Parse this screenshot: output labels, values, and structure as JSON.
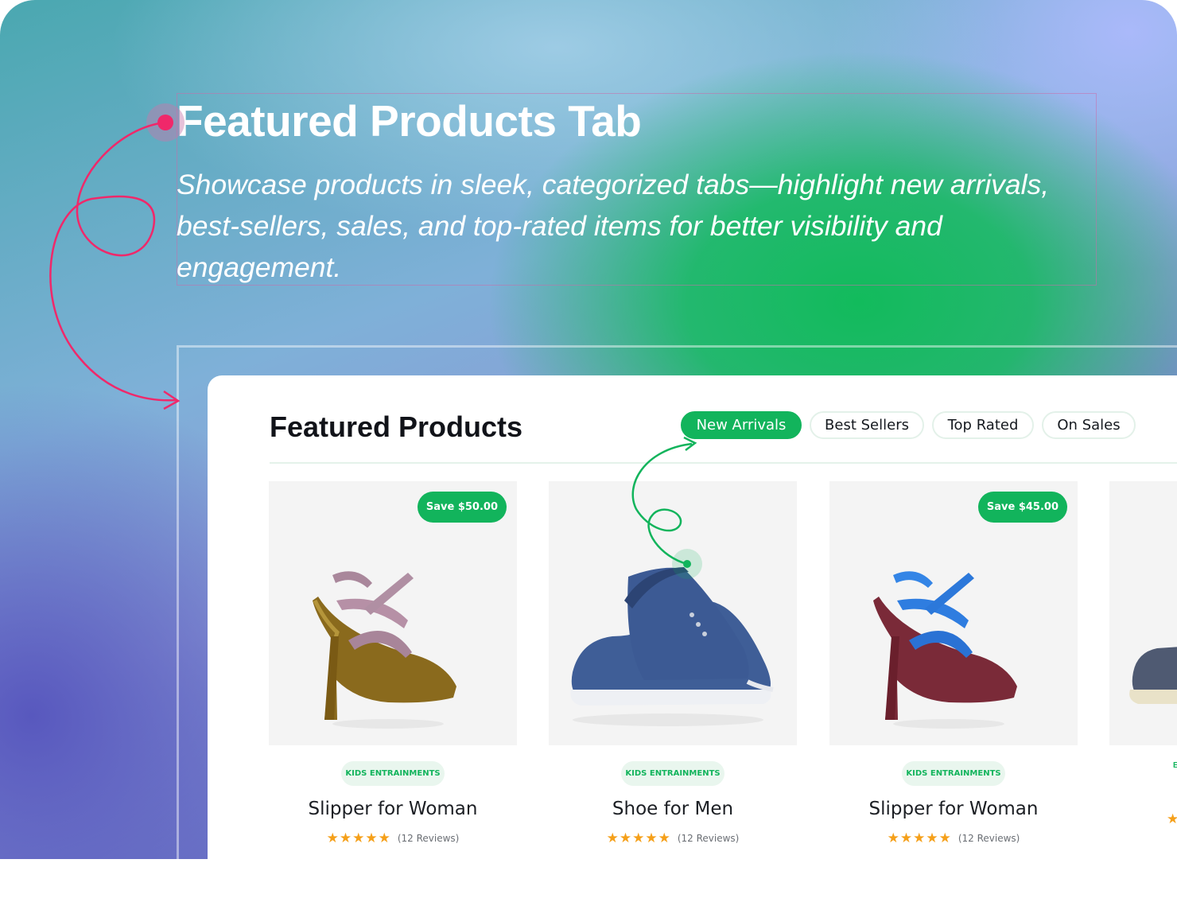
{
  "hero": {
    "title": "Featured Products Tab",
    "description": "Showcase products in sleek, categorized tabs—highlight new arrivals, best-sellers, sales, and top-rated items for better visibility and engagement."
  },
  "panel": {
    "title": "Featured Products",
    "tabs": [
      {
        "label": "New Arrivals",
        "active": true
      },
      {
        "label": "Best Sellers",
        "active": false
      },
      {
        "label": "Top Rated",
        "active": false
      },
      {
        "label": "On Sales",
        "active": false
      }
    ]
  },
  "products": [
    {
      "name": "Slipper for Woman",
      "category": "KIDS ENTRAINMENTS",
      "badge": "Save $50.00",
      "stars": "★★★★★",
      "reviews": "(12 Reviews)",
      "image": "high-heel-sandal-gold"
    },
    {
      "name": "Shoe for Men",
      "category": "KIDS ENTRAINMENTS",
      "badge": "",
      "stars": "★★★★★",
      "reviews": "(12 Reviews)",
      "image": "blue-canvas-sneaker"
    },
    {
      "name": "Slipper for Woman",
      "category": "KIDS ENTRAINMENTS",
      "badge": "Save $45.00",
      "stars": "★★★★★",
      "reviews": "(12 Reviews)",
      "image": "high-heel-sandal-blue"
    }
  ],
  "partial_product": {
    "category": "E",
    "stars": "★",
    "image": "canvas-sneaker-partial"
  },
  "colors": {
    "accent": "#12b45c",
    "annotation_pink": "#f0286a",
    "star": "#f5a01a"
  }
}
